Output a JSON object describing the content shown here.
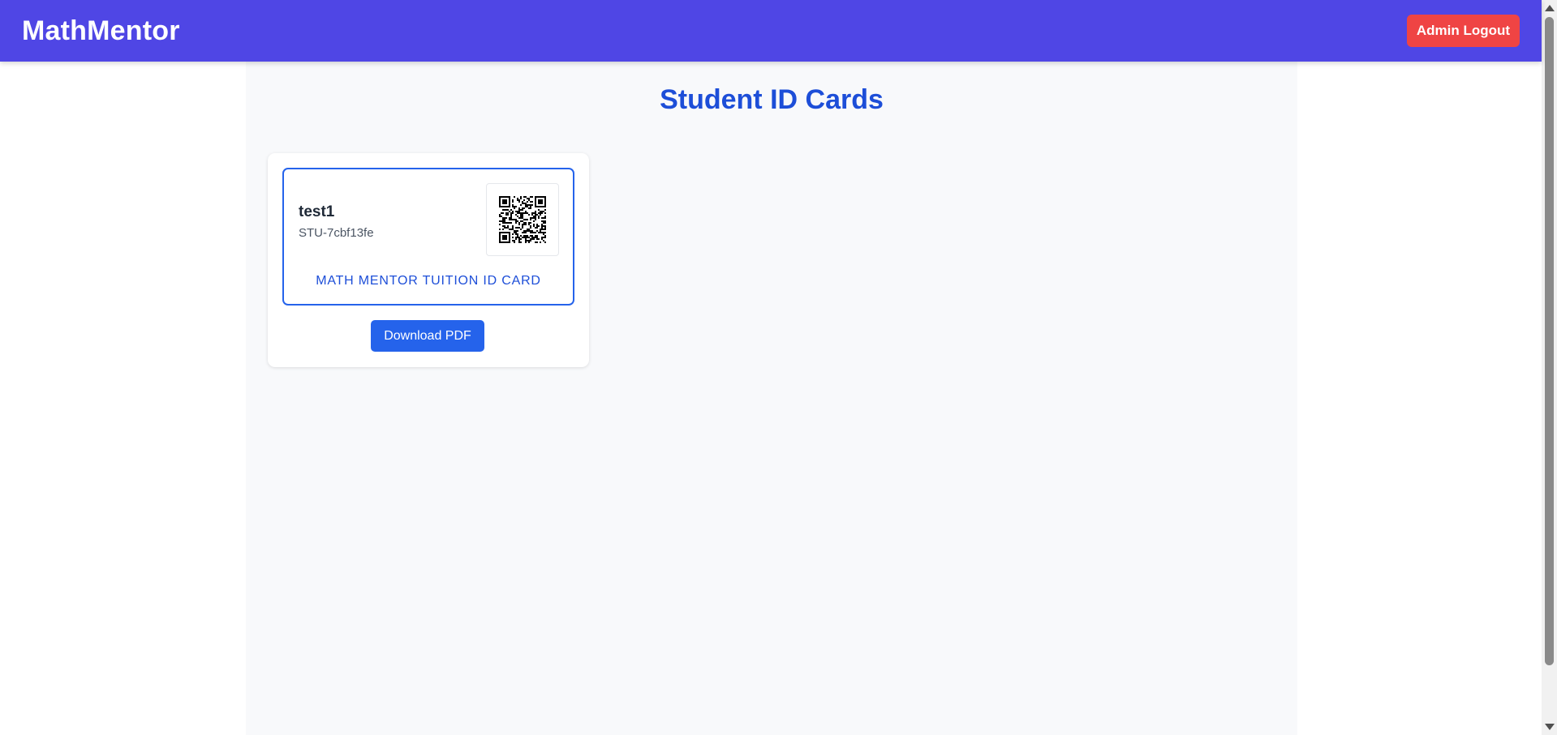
{
  "navbar": {
    "brand": "MathMentor",
    "logout_label": "Admin Logout",
    "brand_color": "#4f46e5",
    "logout_color": "#ef4444"
  },
  "page": {
    "title": "Student ID Cards",
    "title_color": "#1d4ed8"
  },
  "cards": [
    {
      "name": "test1",
      "student_id": "STU-7cbf13fe",
      "qr_icon": "qr-code-icon",
      "footer": "MATH MENTOR TUITION ID CARD",
      "download_label": "Download PDF",
      "accent_color": "#2563eb"
    }
  ]
}
